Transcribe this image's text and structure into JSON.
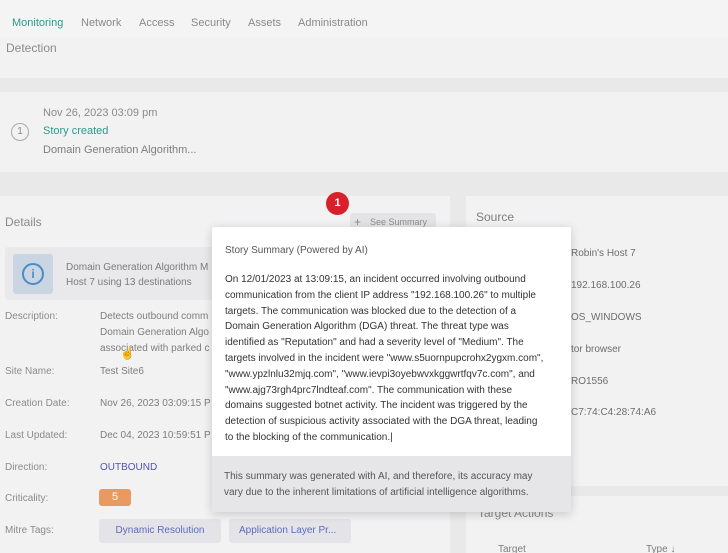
{
  "nav": {
    "tabs": [
      "Monitoring",
      "Network",
      "Access",
      "Security",
      "Assets",
      "Administration"
    ]
  },
  "detection": {
    "title": "Detection"
  },
  "timeline": {
    "step": "1",
    "date": "Nov 26, 2023 03:09 pm",
    "event": "Story created",
    "description": "Domain Generation Algorithm..."
  },
  "details": {
    "title": "Details",
    "see_summary": "See Summary",
    "marker": "1",
    "info_line1": "Domain Generation Algorithm M",
    "info_line2": "Host 7 using 13 destinations",
    "description_label": "Description:",
    "description_lines": [
      "Detects outbound comm",
      "Domain Generation Algo",
      "associated with parked c"
    ],
    "site_label": "Site Name:",
    "site_value": "Test Site6",
    "created_label": "Creation Date:",
    "created_value": "Nov 26, 2023 03:09:15 P",
    "updated_label": "Last Updated:",
    "updated_value": "Dec 04, 2023 10:59:51 P",
    "direction_label": "Direction:",
    "direction_value": "OUTBOUND",
    "criticality_label": "Criticality:",
    "criticality_value": "5",
    "mitre_label": "Mitre Tags:",
    "mitre_tags": [
      "Dynamic Resolution",
      "Application Layer Pr..."
    ]
  },
  "source": {
    "title": "Source",
    "rows": [
      "Robin's Host 7",
      "192.168.100.26",
      "OS_WINDOWS",
      "tor browser",
      "RO1556",
      "C7:74:C4:28:74:A6"
    ]
  },
  "target": {
    "title": "Target Actions",
    "col_target": "Target",
    "col_type": "Type ↓"
  },
  "summary": {
    "title": "Story Summary (Powered by AI)",
    "lines": [
      "On 12/01/2023 at 13:09:15, an incident occurred involving outbound",
      "communication from the client IP address \"192.168.100.26\" to multiple",
      "targets. The communication was blocked due to the detection of a",
      "Domain Generation Algorithm (DGA) threat. The threat type was",
      "identified as \"Reputation\" and had a severity level of \"Medium\". The",
      "targets involved in the incident were \"www.s5uornpupcrohx2ygxm.com\",",
      "\"www.ypzlnlu32mjq.com\", \"www.ievpi3oyebwvxkggwrtfqv7c.com\", and",
      "\"www.ajg73rgh4prc7lndteaf.com\". The communication with these",
      "domains suggested botnet activity. The incident was triggered by the",
      "detection of suspicious activity associated with the DGA threat, leading",
      "to the blocking of the communication.|"
    ],
    "disclaimer_lines": [
      "This summary was generated with AI, and therefore, its accuracy may",
      "vary due to the inherent limitations of artificial intelligence algorithms."
    ]
  }
}
